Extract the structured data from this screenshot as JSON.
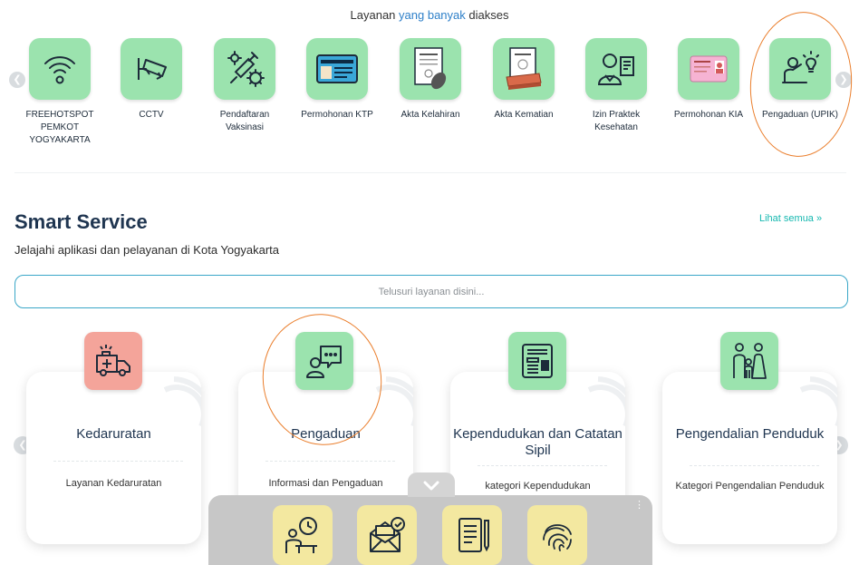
{
  "popular": {
    "title_pre": "Layanan ",
    "title_accent": "yang banyak",
    "title_post": " diakses",
    "items": [
      {
        "label": "FREEHOTSPOT PEMKOT YOGYAKARTA",
        "icon": "wifi-icon"
      },
      {
        "label": "CCTV",
        "icon": "cctv-icon"
      },
      {
        "label": "Pendaftaran Vaksinasi",
        "icon": "syringe-virus-icon"
      },
      {
        "label": "Permohonan KTP",
        "icon": "id-card-icon"
      },
      {
        "label": "Akta Kelahiran",
        "icon": "birth-certificate-icon"
      },
      {
        "label": "Akta Kematian",
        "icon": "death-certificate-icon"
      },
      {
        "label": "Izin Praktek Kesehatan",
        "icon": "doctor-license-icon"
      },
      {
        "label": "Permohonan KIA",
        "icon": "child-id-card-icon"
      },
      {
        "label": "Pengaduan (UPIK)",
        "icon": "complaint-idea-icon"
      }
    ]
  },
  "smart": {
    "title": "Smart Service",
    "subtitle": "Jelajahi aplikasi dan pelayanan di Kota Yogyakarta",
    "see_all": "Lihat semua »",
    "search_placeholder": "Telusuri layanan disini...",
    "cards": [
      {
        "title": "Kedaruratan",
        "desc": "Layanan Kedaruratan",
        "icon": "ambulance-icon",
        "color": "#f4a49a"
      },
      {
        "title": "Pengaduan",
        "desc": "Informasi dan Pengaduan",
        "icon": "chat-support-icon",
        "color": "#9be3ae"
      },
      {
        "title": "Kependudukan dan Catatan Sipil",
        "desc": "kategori Kependudukan",
        "icon": "id-document-icon",
        "color": "#9be3ae"
      },
      {
        "title": "Pengendalian Penduduk",
        "desc": "Kategori Pengendalian Penduduk",
        "icon": "family-icon",
        "color": "#9be3ae"
      }
    ]
  },
  "toolbar": {
    "items": [
      {
        "icon": "work-time-icon"
      },
      {
        "icon": "approved-mail-icon"
      },
      {
        "icon": "document-pen-icon"
      },
      {
        "icon": "fingerprint-icon"
      }
    ],
    "accent": "#f3e8a0"
  },
  "colors": {
    "accent_blue": "#2f80c9",
    "accent_teal": "#16b8b0",
    "tile_green": "#9be3ae",
    "highlight_orange": "#ea7e2c"
  }
}
